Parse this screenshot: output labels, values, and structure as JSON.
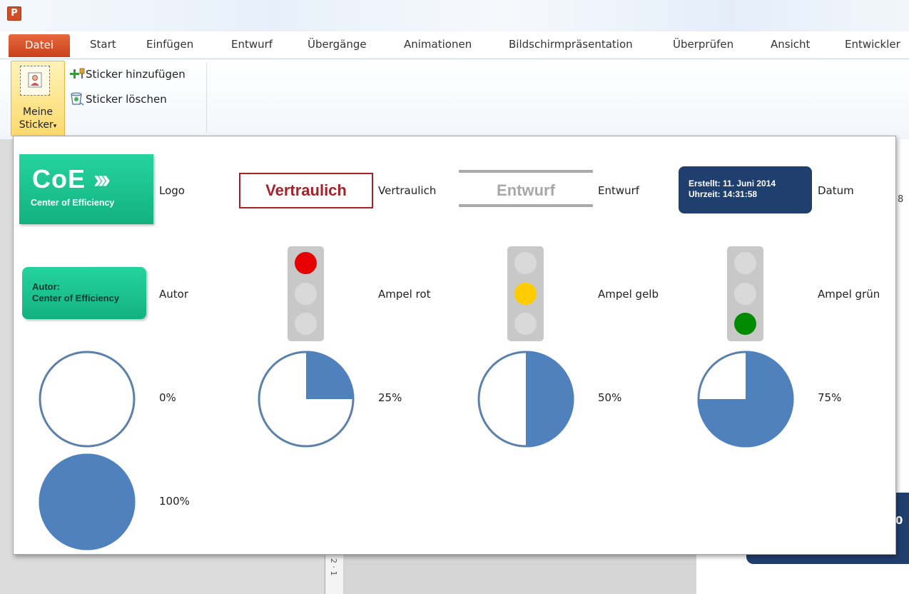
{
  "app": {
    "logo_letter": "P"
  },
  "tabs": {
    "file": "Datei",
    "items": [
      "Start",
      "Einfügen",
      "Entwurf",
      "Übergänge",
      "Animationen",
      "Bildschirmpräsentation",
      "Überprüfen",
      "Ansicht",
      "Entwickler"
    ]
  },
  "ribbon": {
    "meine_sticker_line1": "Meine",
    "meine_sticker_line2": "Sticker",
    "add_sticker": "Sticker hinzufügen",
    "delete_sticker": "Sticker löschen"
  },
  "gallery": {
    "logo": {
      "main": "CoE",
      "sub": "Center of Efficiency",
      "label": "Logo"
    },
    "vertraulich": {
      "stamp": "Vertraulich",
      "label": "Vertraulich"
    },
    "entwurf": {
      "stamp": "Entwurf",
      "label": "Entwurf"
    },
    "datum": {
      "line1": "Erstellt: 11. Juni 2014",
      "line2": "Uhrzeit: 14:31:58",
      "label": "Datum"
    },
    "autor": {
      "line1": "Autor:",
      "line2": "Center of Efficiency",
      "label": "Autor"
    },
    "ampel_rot": {
      "label": "Ampel rot",
      "active": "red"
    },
    "ampel_gelb": {
      "label": "Ampel gelb",
      "active": "yellow"
    },
    "ampel_gruen": {
      "label": "Ampel grün",
      "active": "green"
    },
    "progress": [
      {
        "label": "0%",
        "fraction": 0
      },
      {
        "label": "25%",
        "fraction": 0.25
      },
      {
        "label": "50%",
        "fraction": 0.5
      },
      {
        "label": "75%",
        "fraction": 0.75
      },
      {
        "label": "100%",
        "fraction": 1
      }
    ]
  },
  "background": {
    "ruler_text": "2 · 1",
    "slide_digit": "0",
    "side_digit": "8"
  },
  "colors": {
    "accent_green": "#1bc08c",
    "navy": "#1f3f6e",
    "stamp_red": "#a5222a",
    "pie_blue": "#4f81bd",
    "lamp_red": "#e60000",
    "lamp_yellow": "#ffcc00",
    "lamp_green": "#008a00"
  }
}
